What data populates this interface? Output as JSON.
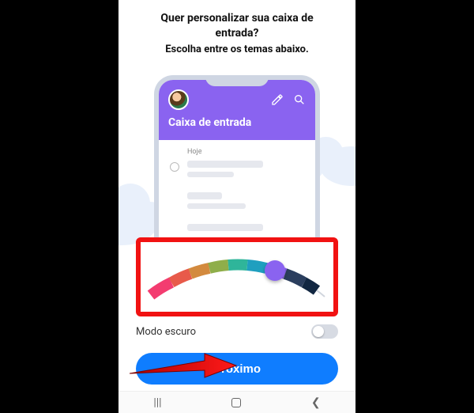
{
  "header": {
    "line1": "Quer personalizar sua caixa de",
    "line2": "entrada?",
    "line3": "Escolha entre os temas abaixo."
  },
  "preview": {
    "inbox_title": "Caixa de entrada",
    "day_label": "Hoje"
  },
  "theme_picker": {
    "colors": [
      "#f33c70",
      "#e85a4a",
      "#d38a3e",
      "#8fae4a",
      "#2fb59a",
      "#1f9fbf",
      "#8a63f0",
      "#2b3e5e",
      "#122742",
      "#ffffff"
    ],
    "selected_color": "#8a63f0"
  },
  "dark_mode": {
    "label": "Modo escuro",
    "enabled": false
  },
  "next_button": {
    "label": "Próximo"
  },
  "accent_color": "#0f7dff"
}
